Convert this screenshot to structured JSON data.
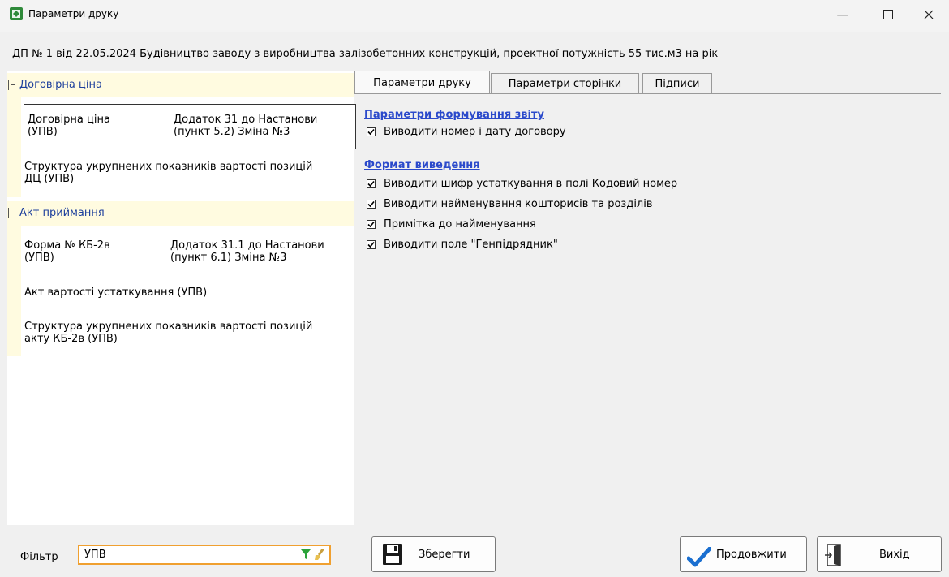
{
  "window": {
    "title": "Параметри друку",
    "min_icon": "minimize-icon",
    "max_icon": "maximize-icon",
    "close_icon": "close-icon"
  },
  "document_line": "ДП № 1 від 22.05.2024  Будівництво заводу з виробництва залізобетонних конструкцій, проектної потужність 55 тис.м3 на рік",
  "tree": {
    "groups": [
      {
        "label": "Договірна ціна",
        "items": [
          {
            "col1_line1": "Договірна ціна",
            "col1_line2": "(УПВ)",
            "col2_line1": "Додаток 31 до Настанови",
            "col2_line2": "(пункт 5.2) Зміна №3",
            "selected": true
          },
          {
            "line1": "Структура укрупнених показників вартості позицій",
            "line2": "ДЦ (УПВ)"
          }
        ]
      },
      {
        "label": "Акт приймання",
        "items": [
          {
            "col1_line1": "Форма № КБ-2в",
            "col1_line2": "(УПВ)",
            "col2_line1": "Додаток 31.1 до Настанови",
            "col2_line2": "(пункт 6.1) Зміна №3"
          },
          {
            "line1": "Акт вартості устаткування (УПВ)"
          },
          {
            "line1": "Структура укрупнених показників вартості позицій",
            "line2": "акту КБ-2в (УПВ)"
          }
        ]
      }
    ]
  },
  "filter": {
    "label": "Фільтр",
    "value": "УПВ"
  },
  "tabs": [
    {
      "label": "Параметри друку",
      "active": true
    },
    {
      "label": "Параметри сторінки",
      "active": false
    },
    {
      "label": "Підписи",
      "active": false
    }
  ],
  "sections": {
    "report": {
      "title": "Параметри формування звіту",
      "options": [
        {
          "label": "Виводити номер і дату договору",
          "checked": true
        }
      ]
    },
    "format": {
      "title": "Формат виведення",
      "options": [
        {
          "label": "Виводити шифр устаткування в полі Кодовий номер",
          "checked": true
        },
        {
          "label": "Виводити найменування кошторисів та розділів",
          "checked": true
        },
        {
          "label": "Примітка до найменування",
          "checked": true
        },
        {
          "label": "Виводити поле \"Генпідрядник\"",
          "checked": true
        }
      ]
    }
  },
  "buttons": {
    "save": "Зберегти",
    "continue": "Продовжити",
    "exit": "Вихід"
  },
  "colors": {
    "accent_blue": "#2b4acb",
    "group_text": "#1d3f9c",
    "group_bg": "#fffbe0",
    "filter_border": "#f0a030",
    "checkmark_blue": "#1a6fd0"
  }
}
